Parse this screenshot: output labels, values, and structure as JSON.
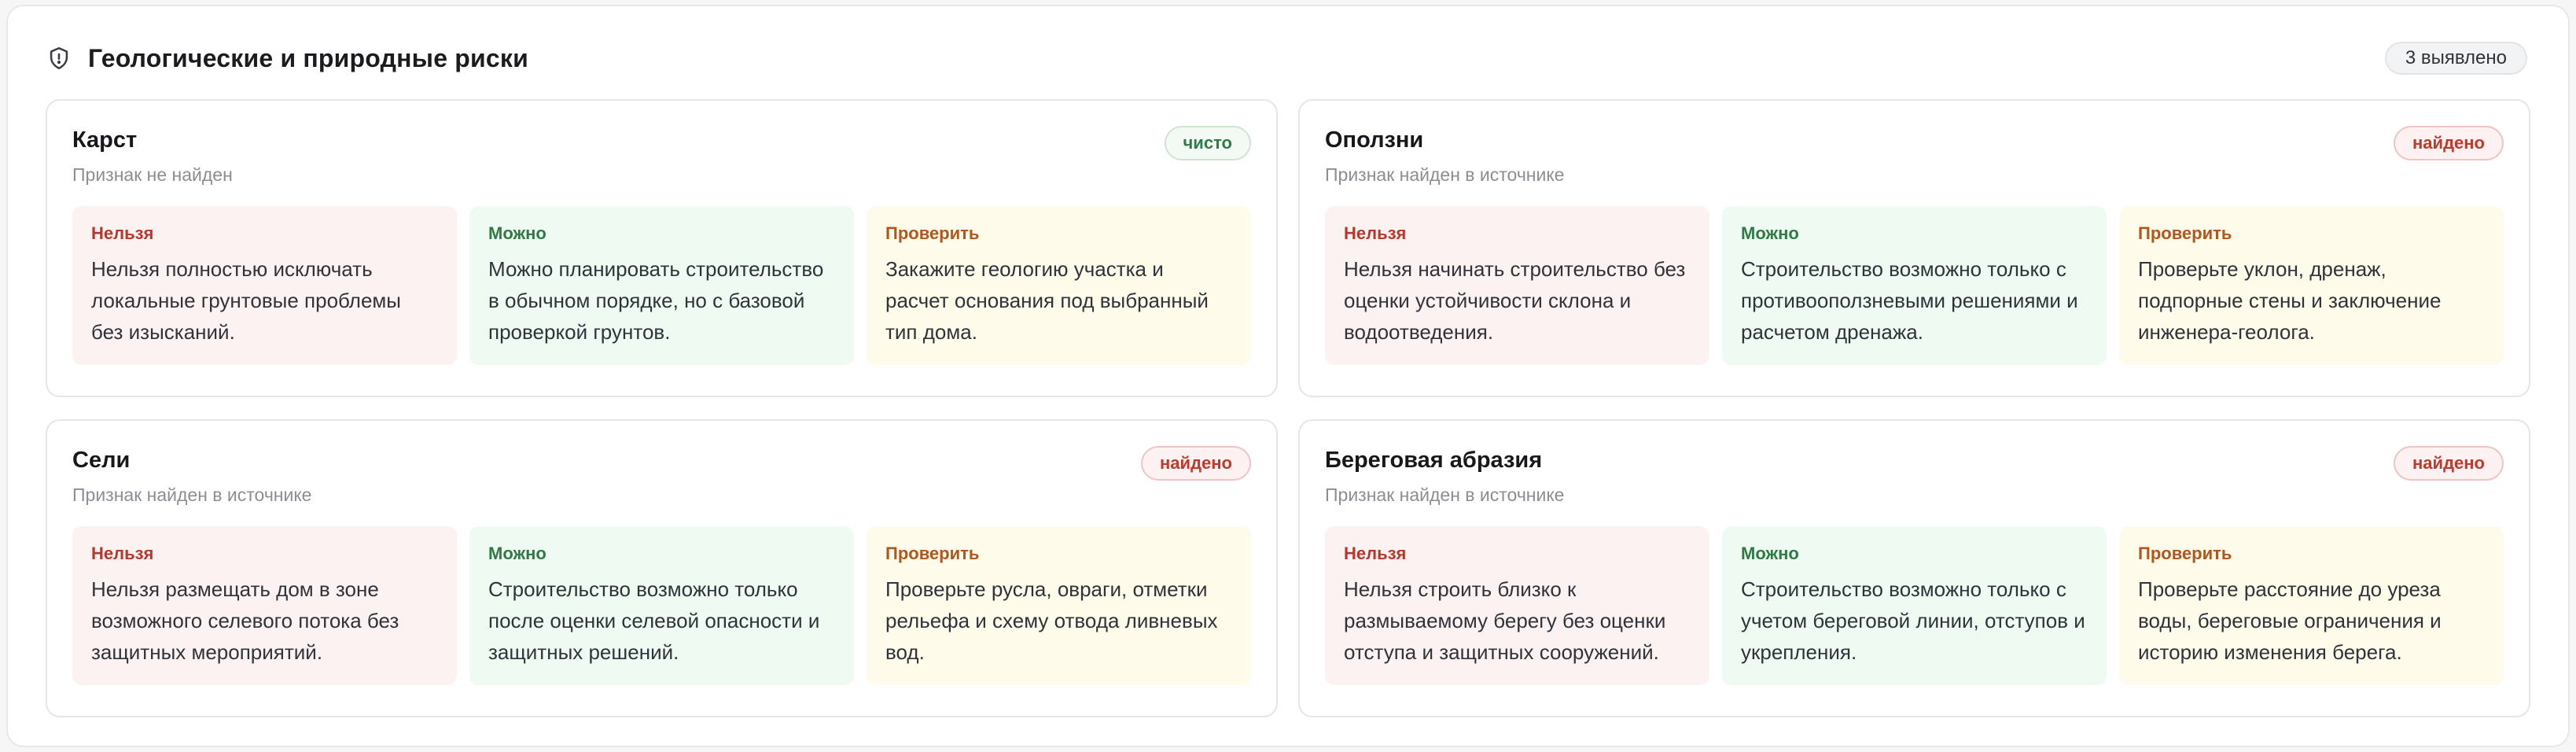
{
  "header": {
    "title": "Геологические и природные риски",
    "count": "3 выявлено"
  },
  "labels": {
    "no": "Нельзя",
    "yes": "Можно",
    "check": "Проверить"
  },
  "cards": [
    {
      "title": "Карст",
      "status": "чисто",
      "subtitle": "Признак не найден",
      "no": "Нельзя полностью исключать локальные грунтовые проблемы без изысканий.",
      "yes": "Можно планировать строительство в обычном порядке, но с базовой проверкой грунтов.",
      "check": "Закажите геологию участка и расчет основания под выбранный тип дома."
    },
    {
      "title": "Оползни",
      "status": "найдено",
      "subtitle": "Признак найден в источнике",
      "no": "Нельзя начинать строительство без оценки устойчивости склона и водоотведения.",
      "yes": "Строительство возможно только с противооползневыми решениями и расчетом дренажа.",
      "check": "Проверьте уклон, дренаж, подпорные стены и заключение инженера-геолога."
    },
    {
      "title": "Сели",
      "status": "найдено",
      "subtitle": "Признак найден в источнике",
      "no": "Нельзя размещать дом в зоне возможного селевого потока без защитных мероприятий.",
      "yes": "Строительство возможно только после оценки селевой опасности и защитных решений.",
      "check": "Проверьте русла, овраги, отметки рельефа и схему отвода ливневых вод."
    },
    {
      "title": "Береговая абразия",
      "status": "найдено",
      "subtitle": "Признак найден в источнике",
      "no": "Нельзя строить близко к размываемому берегу без оценки отступа и защитных сооружений.",
      "yes": "Строительство возможно только с учетом береговой линии, отступов и укрепления.",
      "check": "Проверьте расстояние до уреза воды, береговые ограничения и историю изменения берега."
    }
  ]
}
